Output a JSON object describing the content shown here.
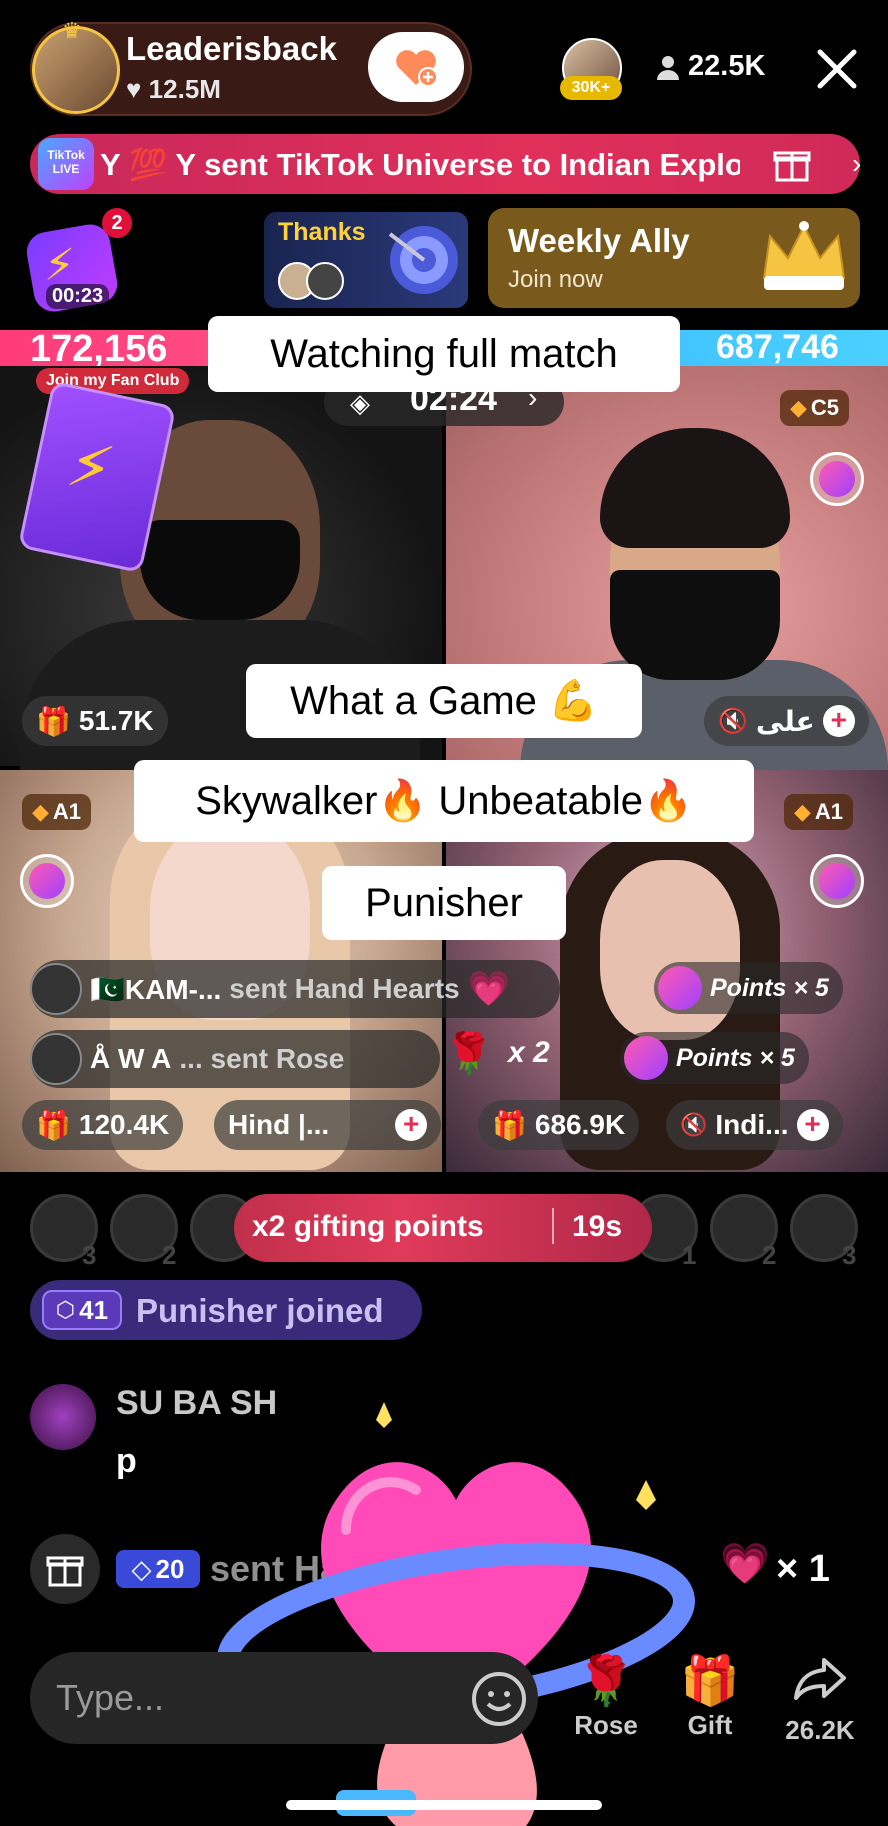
{
  "host": {
    "name": "Leaderisback",
    "likes": "12.5M"
  },
  "viewers": {
    "top_badge": "30K+",
    "count": "22.5K"
  },
  "banner": {
    "logo": "TikTok LIVE",
    "text": "Y 💯 Y sent TikTok Universe to Indian Explore"
  },
  "lightning": {
    "timer": "00:23",
    "notif_count": "2"
  },
  "thanks": {
    "label": "Thanks"
  },
  "weekly": {
    "title": "Weekly Ally",
    "subtitle": "Join now"
  },
  "battle": {
    "left_score": "172,156",
    "right_score": "687,746",
    "timer": "02:24",
    "fan_club": "Join my Fan Club",
    "tiles": {
      "top_left": {
        "stat": "51.7K"
      },
      "top_right": {
        "rank": "C5",
        "name": "علی"
      },
      "bottom_left": {
        "rank": "A1",
        "stat": "120.4K",
        "name": "Hind |..."
      },
      "bottom_right": {
        "rank": "A1",
        "stat": "686.9K",
        "name": "Indi..."
      }
    }
  },
  "bubbles": {
    "watching": "Watching full match",
    "game": "What a Game 💪",
    "skywalker": "Skywalker🔥 Unbeatable🔥",
    "punisher": "Punisher"
  },
  "gift_notifications": [
    {
      "user": "🇵🇰KAM-...",
      "action": "sent Hand Hearts"
    },
    {
      "user": "Å W A",
      "action": "... sent Rose",
      "combo": "x 2"
    }
  ],
  "points_notifications": [
    {
      "label": "Points × 5"
    },
    {
      "label": "Points × 5"
    }
  ],
  "gifting_points": {
    "label": "x2 gifting points",
    "time": "19s"
  },
  "ranking_left": [
    "3",
    "2",
    ""
  ],
  "ranking_right": [
    "1",
    "2",
    "3"
  ],
  "joined": {
    "level": "41",
    "text": "Punisher joined"
  },
  "comment": {
    "name": "SU BA SH",
    "text": "p"
  },
  "gift_line": {
    "coins": "20",
    "text": "sent Hand Hearts",
    "count": "× 1"
  },
  "input": {
    "placeholder": "Type..."
  },
  "actions": {
    "rose": "Rose",
    "gift": "Gift",
    "share": "26.2K"
  },
  "colors": {
    "accent_pink": "#ff3b7a",
    "accent_blue": "#3ab8ff",
    "joined_purple": "#3a2a7a"
  }
}
